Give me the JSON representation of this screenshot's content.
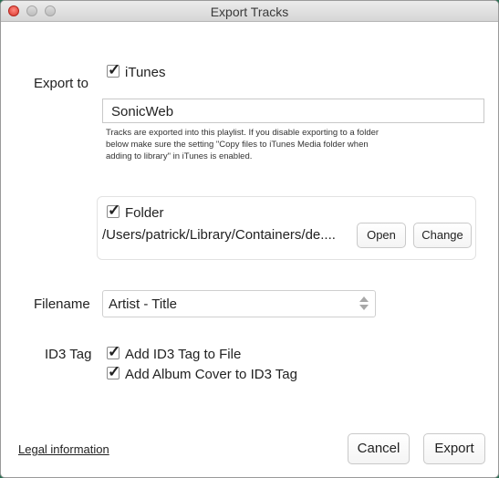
{
  "window": {
    "title": "Export Tracks"
  },
  "export_to": {
    "label": "Export to",
    "itunes_label": "iTunes",
    "itunes_checked": true,
    "playlist_value": "SonicWeb",
    "hint": "Tracks are exported into this playlist. If you disable exporting to a folder below make sure the setting \"Copy files to iTunes Media folder when adding to library\" in iTunes is enabled."
  },
  "folder": {
    "label": "Folder",
    "checked": true,
    "path": "/Users/patrick/Library/Containers/de....",
    "open_label": "Open",
    "change_label": "Change"
  },
  "filename": {
    "label": "Filename",
    "selected": "Artist - Title"
  },
  "id3": {
    "label": "ID3 Tag",
    "add_tag_label": "Add ID3 Tag to File",
    "add_tag_checked": true,
    "add_cover_label": "Add Album Cover to ID3 Tag",
    "add_cover_checked": true
  },
  "footer": {
    "legal_label": "Legal information",
    "cancel_label": "Cancel",
    "export_label": "Export"
  }
}
